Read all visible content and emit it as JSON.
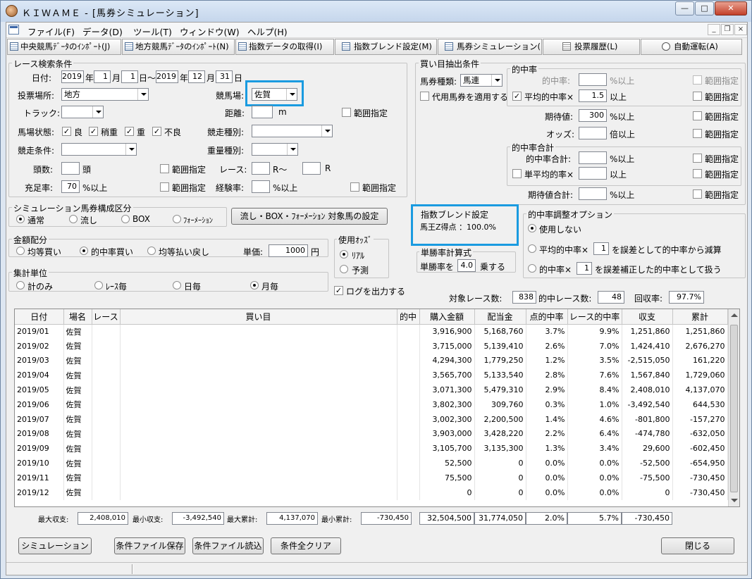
{
  "window": {
    "title": "ＫＩＷＡＭＥ - [馬券シミュレーション]",
    "min": "—",
    "max": "□",
    "close": "✕"
  },
  "menu": [
    "ファイル(F)",
    "データ(D)",
    "ツール(T)",
    "ウィンドウ(W)",
    "ヘルプ(H)"
  ],
  "mdi": {
    "min": "_",
    "restore": "❐",
    "close": "×"
  },
  "toolbar": [
    {
      "label": "中央競馬ﾃﾞｰﾀのｲﾝﾎﾟｰﾄ(J)",
      "icon": "table-icon"
    },
    {
      "label": "地方競馬ﾃﾞｰﾀのｲﾝﾎﾟｰﾄ(N)",
      "icon": "table-icon"
    },
    {
      "label": "指数データの取得(I)",
      "icon": "table-icon"
    },
    {
      "label": "指数ブレンド設定(M)",
      "icon": "table-icon"
    },
    {
      "label": "馬券シミュレーション(B)",
      "icon": "table-icon"
    },
    {
      "label": "投票履歴(L)",
      "icon": "document-icon"
    },
    {
      "label": "自動運転(A)",
      "icon": "clock-icon"
    }
  ],
  "search": {
    "group": "レース検索条件",
    "date_label": "日付:",
    "from_year": "2019",
    "from_month": "1",
    "from_day": "1",
    "to_year": "2019",
    "to_month": "12",
    "to_day": "31",
    "u_year": "年",
    "u_month": "月",
    "u_day_from": "日～",
    "u_day": "日",
    "venue_label": "投票場所:",
    "venue": "地方",
    "track_label": "競馬場:",
    "track": "佐賀",
    "course_label": "トラック:",
    "course": "",
    "distance_label": "距離:",
    "distance": "",
    "distance_unit": "m",
    "distance_range": "範囲指定",
    "cond_label": "馬場状態:",
    "cond": [
      "良",
      "稍重",
      "重",
      "不良"
    ],
    "race_type_label": "競走種別:",
    "race_type": "",
    "race_cond_label": "競走条件:",
    "race_cond": "",
    "weight_type_label": "重量種別:",
    "weight_type": "",
    "heads_label": "頭数:",
    "heads": "",
    "heads_unit": "頭",
    "heads_range": "範囲指定",
    "race_label": "レース:",
    "race_from": "",
    "race_from_unit": "R～",
    "race_to": "",
    "race_to_unit": "R",
    "fill_label": "充足率:",
    "fill": "70",
    "fill_unit": "%以上",
    "fill_range": "範囲指定",
    "exp_label": "経験率:",
    "exp": "",
    "exp_unit": "%以上",
    "exp_range": "範囲指定"
  },
  "sim": {
    "group": "シミュレーション馬券構成区分",
    "options": [
      "通常",
      "流し",
      "BOX",
      "ﾌｫｰﾒｰｼｮﾝ"
    ],
    "selected": 0,
    "target_button": "流し・BOX・ﾌｫｰﾒｰｼｮﾝ 対象馬の設定"
  },
  "money": {
    "group": "金額配分",
    "options": [
      "均等買い",
      "的中率買い",
      "均等払い戻し"
    ],
    "selected": 1,
    "unit_label": "単価:",
    "unit": "1000",
    "unit_suffix": "円"
  },
  "odds": {
    "group": "使用ｵｯｽﾞ",
    "options": [
      "ﾘｱﾙ",
      "予測"
    ],
    "selected": 0
  },
  "agg": {
    "group": "集計単位",
    "options": [
      "計のみ",
      "ﾚｰｽ毎",
      "日毎",
      "月毎"
    ],
    "selected": 3
  },
  "log_label": "ログを出力する",
  "buy": {
    "group": "買い目抽出条件",
    "type_label": "馬券種類:",
    "type": "馬連",
    "proxy_label": "代用馬券を適用する",
    "hit_group": "的中率",
    "hit_label": "的中率:",
    "hit": "",
    "hit_unit": "%以上",
    "avg_label": "平均的中率×",
    "avg": "1.5",
    "avg_unit": "以上",
    "ev_label": "期待値:",
    "ev": "300",
    "ev_unit": "%以上",
    "odds_label": "オッズ:",
    "odds": "",
    "odds_unit": "倍以上",
    "sum_group": "的中率合計",
    "sum_label": "的中率合計:",
    "sum": "",
    "sum_unit": "%以上",
    "single_label": "単平均的率×",
    "single": "",
    "single_unit": "以上",
    "evsum_label": "期待値合計:",
    "evsum": "",
    "evsum_unit": "%以上",
    "range": "範囲指定"
  },
  "blend": {
    "group": "指数ブレンド設定",
    "text": "馬王Z得点 ：100.0%"
  },
  "adjust": {
    "group": "的中率調整オプション",
    "none": "使用しない",
    "opt1_pre": "平均的中率×",
    "opt1_val": "1",
    "opt1_post": "を誤差として的中率から減算",
    "opt2_pre": "的中率×",
    "opt2_val": "1",
    "opt2_post": "を誤差補正した的中率として扱う"
  },
  "win": {
    "group": "単勝率計算式",
    "pre": "単勝率を",
    "val": "4.0",
    "post": "乗する"
  },
  "summary": {
    "races_label": "対象レース数:",
    "races": "838",
    "hits_label": "的中レース数:",
    "hits": "48",
    "return_label": "回収率:",
    "return": "97.7%"
  },
  "table": {
    "headers": [
      "日付",
      "場名",
      "レース",
      "買い目",
      "的中",
      "購入金額",
      "配当金",
      "点的中率",
      "レース的中率",
      "収支",
      "累計"
    ],
    "rows": [
      [
        "2019/01",
        "佐賀",
        "",
        "",
        "",
        "3,916,900",
        "5,168,760",
        "3.7%",
        "9.9%",
        "1,251,860",
        "1,251,860"
      ],
      [
        "2019/02",
        "佐賀",
        "",
        "",
        "",
        "3,715,000",
        "5,139,410",
        "2.6%",
        "7.0%",
        "1,424,410",
        "2,676,270"
      ],
      [
        "2019/03",
        "佐賀",
        "",
        "",
        "",
        "4,294,300",
        "1,779,250",
        "1.2%",
        "3.5%",
        "-2,515,050",
        "161,220"
      ],
      [
        "2019/04",
        "佐賀",
        "",
        "",
        "",
        "3,565,700",
        "5,133,540",
        "2.8%",
        "7.6%",
        "1,567,840",
        "1,729,060"
      ],
      [
        "2019/05",
        "佐賀",
        "",
        "",
        "",
        "3,071,300",
        "5,479,310",
        "2.9%",
        "8.4%",
        "2,408,010",
        "4,137,070"
      ],
      [
        "2019/06",
        "佐賀",
        "",
        "",
        "",
        "3,802,300",
        "309,760",
        "0.3%",
        "1.0%",
        "-3,492,540",
        "644,530"
      ],
      [
        "2019/07",
        "佐賀",
        "",
        "",
        "",
        "3,002,300",
        "2,200,500",
        "1.4%",
        "4.6%",
        "-801,800",
        "-157,270"
      ],
      [
        "2019/08",
        "佐賀",
        "",
        "",
        "",
        "3,903,000",
        "3,428,220",
        "2.2%",
        "6.4%",
        "-474,780",
        "-632,050"
      ],
      [
        "2019/09",
        "佐賀",
        "",
        "",
        "",
        "3,105,700",
        "3,135,300",
        "1.3%",
        "3.4%",
        "29,600",
        "-602,450"
      ],
      [
        "2019/10",
        "佐賀",
        "",
        "",
        "",
        "52,500",
        "0",
        "0.0%",
        "0.0%",
        "-52,500",
        "-654,950"
      ],
      [
        "2019/11",
        "佐賀",
        "",
        "",
        "",
        "75,500",
        "0",
        "0.0%",
        "0.0%",
        "-75,500",
        "-730,450"
      ],
      [
        "2019/12",
        "佐賀",
        "",
        "",
        "",
        "0",
        "0",
        "0.0%",
        "0.0%",
        "0",
        "-730,450"
      ]
    ]
  },
  "footer": {
    "max_inc_label": "最大収支:",
    "max_inc": "2,408,010",
    "min_inc_label": "最小収支:",
    "min_inc": "-3,492,540",
    "max_cum_label": "最大累計:",
    "max_cum": "4,137,070",
    "min_cum_label": "最小累計:",
    "min_cum": "-730,450",
    "total_buy": "32,504,500",
    "total_pay": "31,774,050",
    "total_hit": "2.0%",
    "total_race_hit": "5.7%",
    "total_inc": "-730,450"
  },
  "buttons": {
    "simulate": "シミュレーション",
    "save": "条件ファイル保存",
    "load": "条件ファイル読込",
    "clear": "条件全クリア",
    "close": "閉じる"
  }
}
